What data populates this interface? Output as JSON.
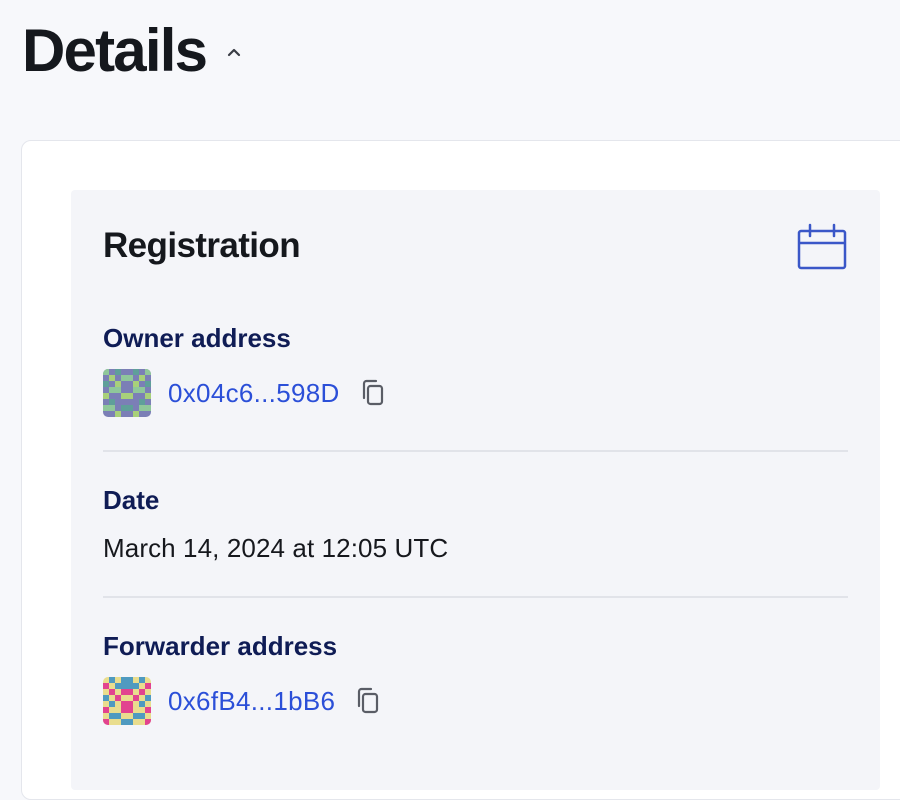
{
  "header": {
    "title": "Details",
    "toggle_icon": "chevron-up-icon"
  },
  "registration": {
    "title": "Registration",
    "icon": "calendar-icon",
    "accent_color": "#3a57c8",
    "owner": {
      "label": "Owner address",
      "address": "0x04c6...598D",
      "avatar": "identicon-avatar",
      "copy_icon": "copy-icon"
    },
    "date": {
      "label": "Date",
      "value": "March 14, 2024 at 12:05 UTC"
    },
    "forwarder": {
      "label": "Forwarder address",
      "address": "0x6fB4...1bB6",
      "avatar": "identicon-avatar",
      "copy_icon": "copy-icon"
    }
  },
  "colors": {
    "page_bg": "#f7f8fb",
    "card_bg": "#ffffff",
    "panel_bg": "#f4f5f9",
    "label": "#0f1c55",
    "link": "#2b4fd8"
  }
}
